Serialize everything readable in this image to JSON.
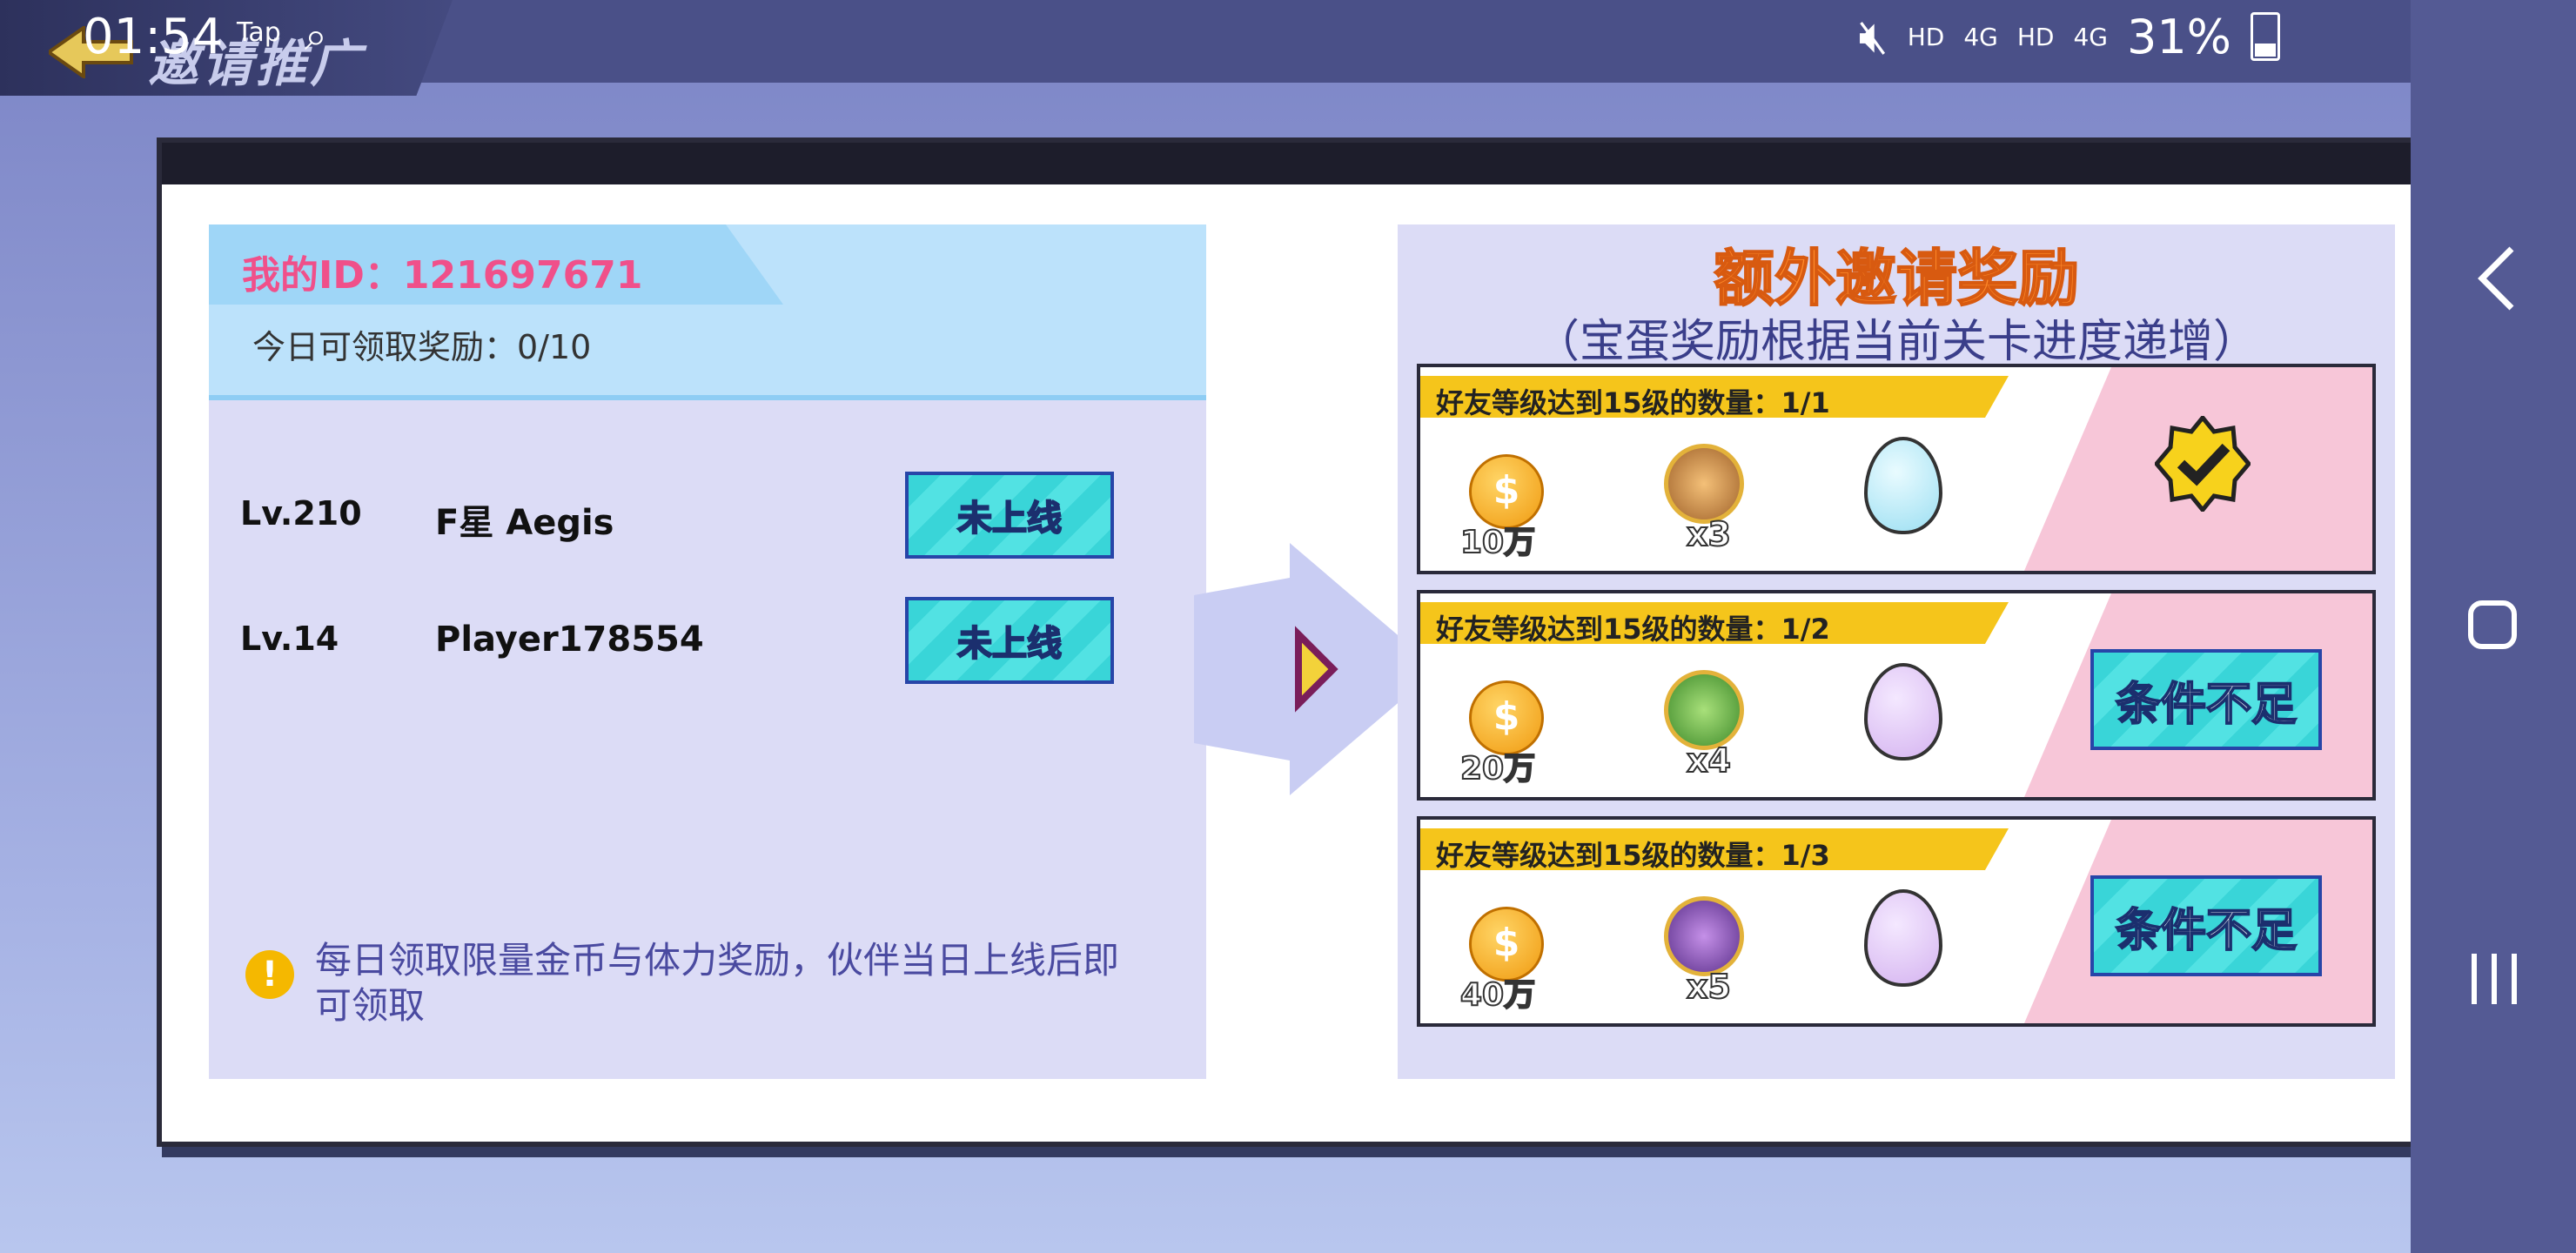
{
  "status_bar": {
    "time": "01:54",
    "app_tag": "Tap",
    "signal_labels": [
      "HD",
      "4G",
      "HD",
      "4G"
    ],
    "battery": "31%"
  },
  "game": {
    "screen_title": "邀请推广"
  },
  "left_panel": {
    "my_id": "我的ID：121697671",
    "today_claimable": "今日可领取奖励：0/10",
    "friends": [
      {
        "level": "Lv.210",
        "name": "F星 Aegis",
        "status": "未上线"
      },
      {
        "level": "Lv.14",
        "name": "Player178554",
        "status": "未上线"
      }
    ],
    "note": "每日领取限量金币与体力奖励，伙伴当日上线后即可领取"
  },
  "right_panel": {
    "title": "额外邀请奖励",
    "subtitle": "（宝蛋奖励根据当前关卡进度递增）",
    "rewards": [
      {
        "condition": "好友等级达到15级的数量：1/1",
        "coins": "10万",
        "pet_multiplier": "x3",
        "egg_color": "blue",
        "state": "claimed",
        "button": ""
      },
      {
        "condition": "好友等级达到15级的数量：1/2",
        "coins": "20万",
        "pet_multiplier": "x4",
        "egg_color": "purple",
        "state": "locked",
        "button": "条件不足"
      },
      {
        "condition": "好友等级达到15级的数量：1/3",
        "coins": "40万",
        "pet_multiplier": "x5",
        "egg_color": "purple",
        "state": "locked",
        "button": "条件不足"
      }
    ]
  },
  "colors": {
    "accent_pink": "#f0508a",
    "title_orange": "#ff8a2a",
    "button_cyan": "#39d5d8",
    "condition_yellow": "#f5c51b"
  }
}
